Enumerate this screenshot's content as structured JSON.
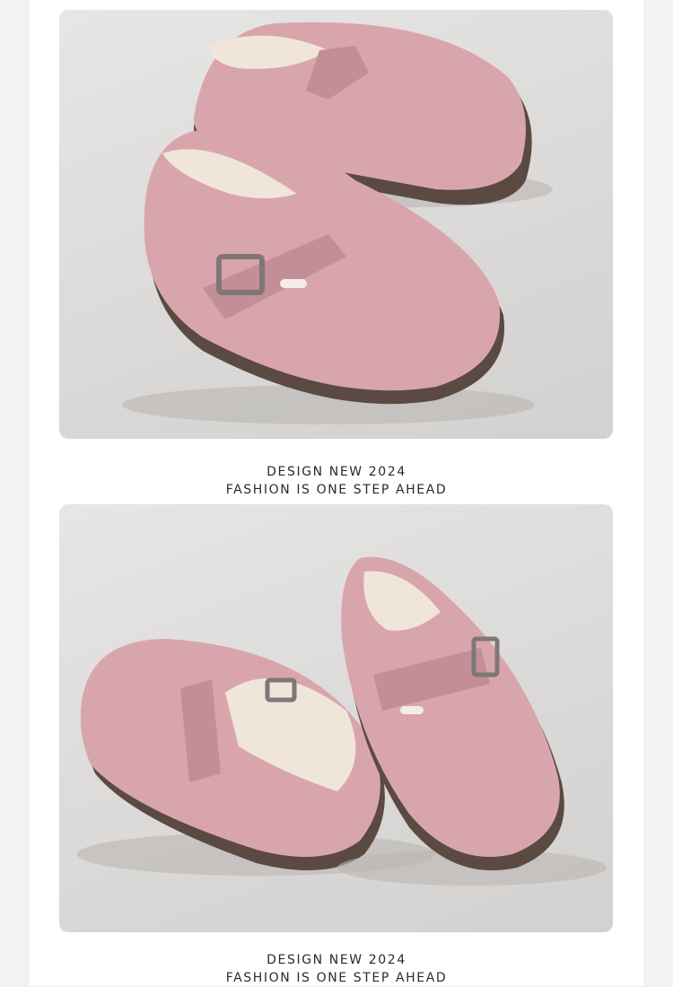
{
  "captions": [
    {
      "line1": "DESIGN NEW 2024",
      "line2": "FASHION IS ONE STEP AHEAD"
    },
    {
      "line1": "DESIGN NEW 2024",
      "line2": "FASHION IS ONE STEP AHEAD"
    }
  ],
  "colors": {
    "suede": "#d9a5ac",
    "suede_shadow": "#c48e96",
    "fleece": "#efe5d8",
    "sole": "#5a4a42",
    "buckle": "#7d7877",
    "backdrop": "#dddbd9"
  }
}
